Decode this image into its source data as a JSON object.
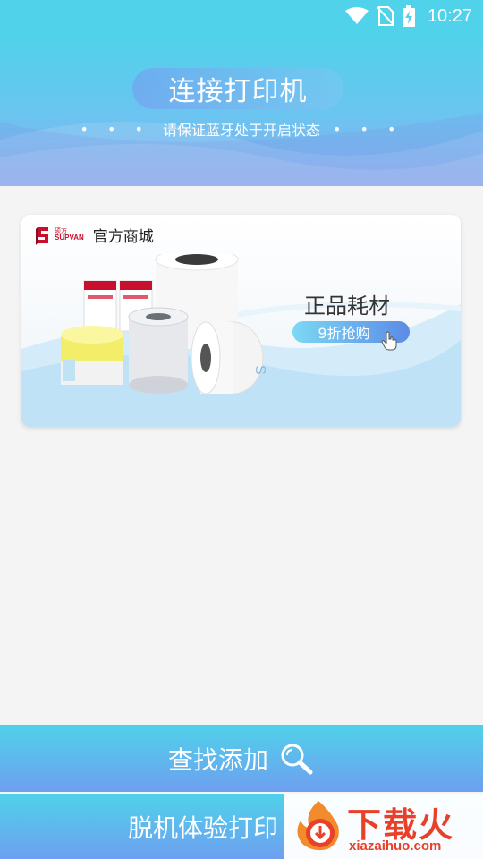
{
  "status_bar": {
    "time": "10:27",
    "icons": [
      "wifi-icon",
      "no-sim-icon",
      "battery-charging-icon"
    ]
  },
  "header": {
    "title": "连接打印机",
    "dots_left": "• • •",
    "subtitle": "请保证蓝牙处于开启状态",
    "dots_right": "• • •"
  },
  "banner": {
    "brand_cn": "硕方",
    "brand_en": "SUPVAN",
    "store_label": "官方商城",
    "promo_title": "正品耗材",
    "promo_button": "9折抢购"
  },
  "actions": {
    "search_add": "查找添加",
    "offline_print": "脱机体验打印"
  },
  "watermark": {
    "title": "下载火",
    "url": "xiazaihuo.com"
  },
  "colors": {
    "accent_cyan": "#4fd2ea",
    "accent_blue": "#6e9ff0",
    "brand_red": "#c8102e",
    "watermark_red": "#e8412a"
  }
}
